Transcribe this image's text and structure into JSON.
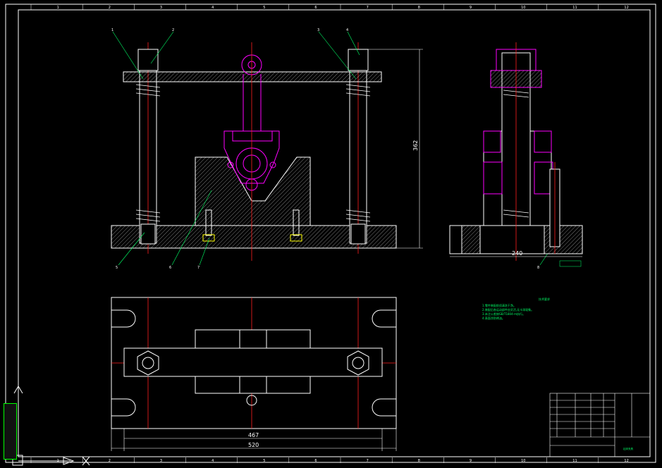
{
  "colors": {
    "background": "#000000",
    "line": "#ffffff",
    "center": "#ff2020",
    "part": "#ff00ff",
    "note": "#00ff66",
    "frame_ticks": "#ffffff"
  },
  "frame": {
    "top_numbers": [
      "1",
      "2",
      "3",
      "4",
      "5",
      "6",
      "7",
      "8",
      "9",
      "10",
      "11",
      "12"
    ],
    "bottom_numbers": [
      "1",
      "2",
      "3",
      "4",
      "5",
      "6",
      "7",
      "8",
      "9",
      "10",
      "11",
      "12"
    ]
  },
  "dimensions": {
    "height": "362",
    "side_width": "240",
    "inner_span": "467",
    "outer_span": "520"
  },
  "balloons": {
    "front_top": [
      "1",
      "2",
      "3",
      "4"
    ],
    "front_bottom": [
      "5",
      "6",
      "7"
    ],
    "side": [
      "8"
    ]
  },
  "notes": {
    "heading": "技术要求",
    "lines": [
      "1.零件装配前须清洗干净。",
      "2.装配后各运动部件应灵活,无卡滞现象。",
      "3.未注公差按GB/T1804-m执行。",
      "4.表面涂防锈油。"
    ]
  },
  "title_block": {
    "drawing_title": "钻床夹具"
  },
  "icons": [
    "ucs-y-axis-icon",
    "ucs-x-axis-icon",
    "ucs-cross-icon"
  ]
}
